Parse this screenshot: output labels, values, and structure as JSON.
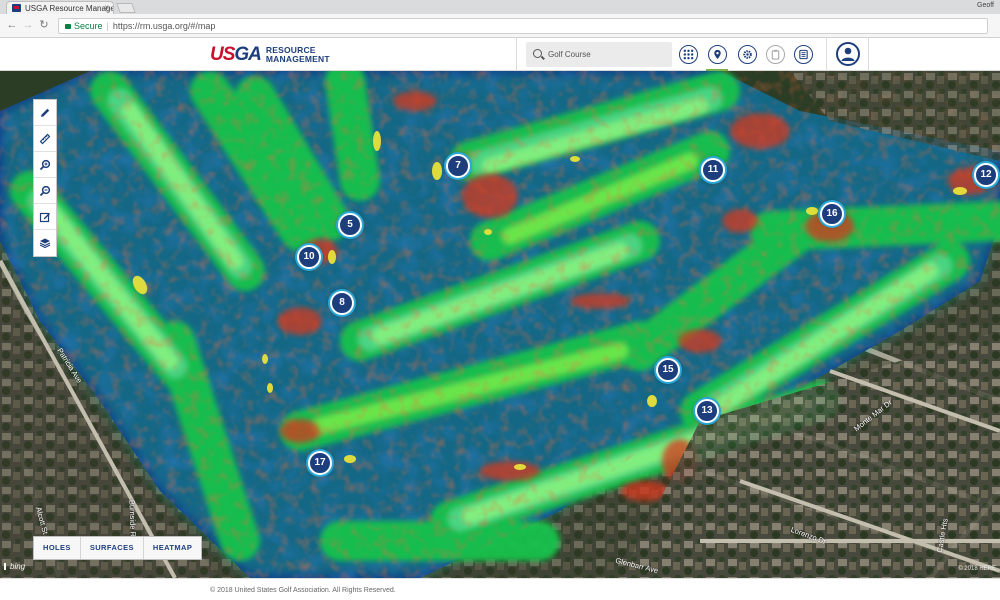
{
  "browser": {
    "tab_title": "USGA Resource Managem",
    "tab_close": "×",
    "profile_name": "Geoff",
    "secure_label": "Secure",
    "url": "https://rm.usga.org/#/map"
  },
  "header": {
    "logo_text_u": "US",
    "logo_text_g": "GA",
    "logo_sub_line1": "RESOURCE",
    "logo_sub_line2": "MANAGEMENT",
    "search_placeholder": "Golf Course"
  },
  "header_icons": [
    "grid-icon",
    "map-pin-icon",
    "gear-icon",
    "clipboard-icon",
    "list-icon",
    "user-icon"
  ],
  "map_tools": [
    "pencil-icon",
    "ruler-icon",
    "zoom-in-icon",
    "zoom-out-icon",
    "edit-icon",
    "layers-icon"
  ],
  "holes": [
    "5",
    "7",
    "8",
    "10",
    "11",
    "12",
    "13",
    "15",
    "16",
    "17"
  ],
  "streets": {
    "patricia": "Patricia Ave",
    "monte_mar": "Monte Mar Dr",
    "lorenzo": "Lorenzo Dr",
    "glenbarr": "Glenbarr Ave",
    "alcott": "Alcott St",
    "burnside": "Burnside Rd",
    "castle": "Castle Hts"
  },
  "mode_buttons": [
    "HOLES",
    "SURFACES",
    "HEATMAP"
  ],
  "bing_label": "bing",
  "map_credit": "© 2018 HERE",
  "footer_text": "© 2018 United States Golf Association. All Rights Reserved.",
  "colors": {
    "brand_navy": "#1d3e7c",
    "brand_red": "#c8102e",
    "active_underline": "#7ab34a",
    "pin_ring": "#2aa7d6"
  }
}
